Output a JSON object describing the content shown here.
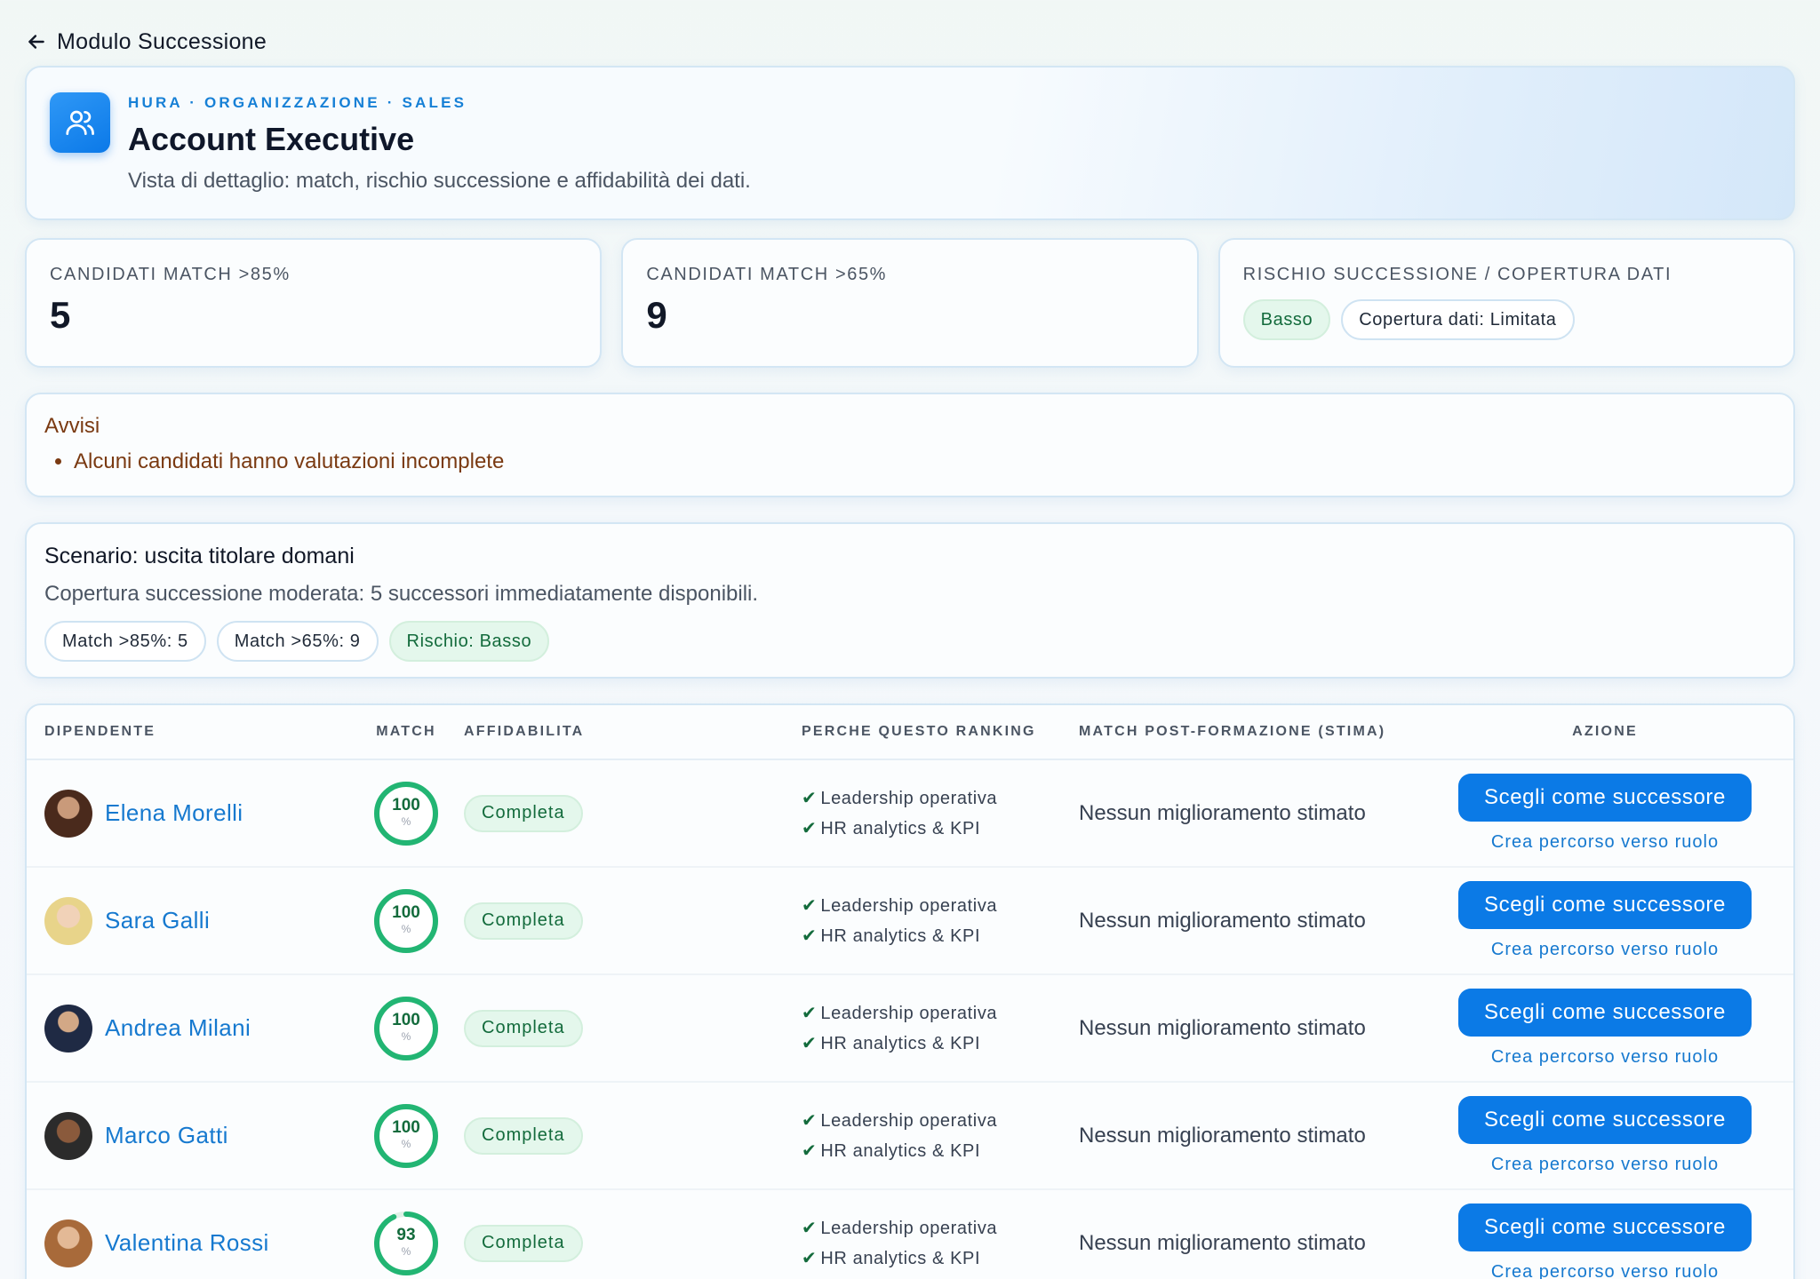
{
  "nav": {
    "back_label": "Modulo Successione"
  },
  "hero": {
    "eyebrow": "HURA · ORGANIZZAZIONE · SALES",
    "title": "Account Executive",
    "subtitle": "Vista di dettaglio: match, rischio successione e affidabilità dei dati."
  },
  "stats": {
    "match85": {
      "label": "CANDIDATI MATCH >85%",
      "value": "5"
    },
    "match65": {
      "label": "CANDIDATI MATCH >65%",
      "value": "9"
    },
    "risk": {
      "label": "RISCHIO SUCCESSIONE / COPERTURA DATI",
      "risk_badge": "Basso",
      "coverage_badge": "Copertura dati: Limitata"
    }
  },
  "alerts": {
    "title": "Avvisi",
    "items": [
      "Alcuni candidati hanno valutazioni incomplete"
    ]
  },
  "scenario": {
    "title": "Scenario: uscita titolare domani",
    "text": "Copertura successione moderata: 5 successori immediatamente disponibili.",
    "pills": [
      "Match >85%: 5",
      "Match >65%: 9",
      "Rischio: Basso"
    ]
  },
  "table": {
    "headers": [
      "DIPENDENTE",
      "MATCH",
      "AFFIDABILITA",
      "PERCHE QUESTO RANKING",
      "MATCH POST-FORMAZIONE (STIMA)",
      "AZIONE"
    ],
    "rows": [
      {
        "name": "Elena Morelli",
        "match": "100",
        "match_pct": 100,
        "unit": "%",
        "reliability": "Completa",
        "reasons": [
          "Leadership operativa",
          "HR analytics & KPI"
        ],
        "post": "Nessun miglioramento stimato",
        "primary": "Scegli come successore",
        "secondary": "Crea percorso verso ruolo"
      },
      {
        "name": "Sara Galli",
        "match": "100",
        "match_pct": 100,
        "unit": "%",
        "reliability": "Completa",
        "reasons": [
          "Leadership operativa",
          "HR analytics & KPI"
        ],
        "post": "Nessun miglioramento stimato",
        "primary": "Scegli come successore",
        "secondary": "Crea percorso verso ruolo"
      },
      {
        "name": "Andrea Milani",
        "match": "100",
        "match_pct": 100,
        "unit": "%",
        "reliability": "Completa",
        "reasons": [
          "Leadership operativa",
          "HR analytics & KPI"
        ],
        "post": "Nessun miglioramento stimato",
        "primary": "Scegli come successore",
        "secondary": "Crea percorso verso ruolo"
      },
      {
        "name": "Marco Gatti",
        "match": "100",
        "match_pct": 100,
        "unit": "%",
        "reliability": "Completa",
        "reasons": [
          "Leadership operativa",
          "HR analytics & KPI"
        ],
        "post": "Nessun miglioramento stimato",
        "primary": "Scegli come successore",
        "secondary": "Crea percorso verso ruolo"
      },
      {
        "name": "Valentina Rossi",
        "match": "93",
        "match_pct": 93,
        "unit": "%",
        "reliability": "Completa",
        "reasons": [
          "Leadership operativa",
          "HR analytics & KPI"
        ],
        "post": "Nessun miglioramento stimato",
        "primary": "Scegli come successore",
        "secondary": "Crea percorso verso ruolo"
      }
    ]
  },
  "colors": {
    "accent": "#0b7ae6",
    "success": "#136b3c",
    "success_bg": "#e4f7ec",
    "warning_text": "#7a3a12"
  }
}
